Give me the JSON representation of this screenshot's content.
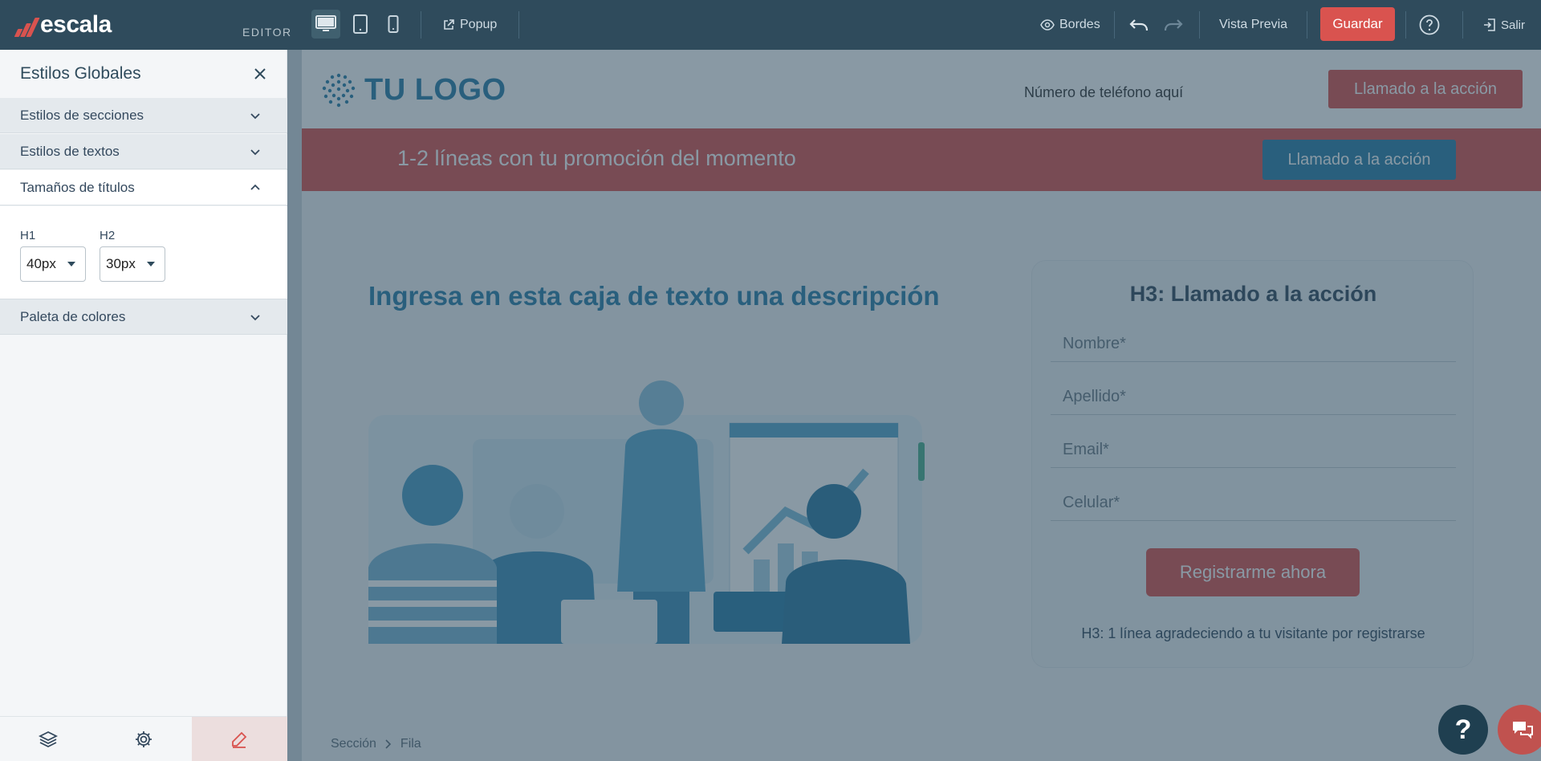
{
  "topbar": {
    "brand": "escala",
    "editor_label": "EDITOR",
    "popup_label": "Popup",
    "borders_label": "Bordes",
    "preview_label": "Vista Previa",
    "save_label": "Guardar",
    "exit_label": "Salir"
  },
  "sidebar": {
    "title": "Estilos Globales",
    "sections": [
      {
        "label": "Estilos de secciones"
      },
      {
        "label": "Estilos de textos"
      },
      {
        "label": "Tamaños de títulos"
      },
      {
        "label": "Paleta de colores"
      }
    ],
    "h1_label": "H1",
    "h1_value": "40px",
    "h2_label": "H2",
    "h2_value": "30px"
  },
  "page": {
    "logo": "TU LOGO",
    "phone": "Número de teléfono aquí",
    "header_cta": "Llamado a la acción",
    "promo_text": "1-2 líneas con tu promoción del momento",
    "promo_cta": "Llamado a la acción",
    "description": "Ingresa  en esta caja de texto una descripción",
    "form": {
      "title": "H3: Llamado a la acción",
      "fields": [
        "Nombre*",
        "Apellido*",
        "Email*",
        "Celular*"
      ],
      "submit": "Registrarme ahora",
      "note": "H3: 1 línea agradeciendo a tu visitante por registrarse"
    }
  },
  "breadcrumb": [
    "Sección",
    "Fila"
  ],
  "help_label": "?",
  "colors": {
    "topbar": "#2f4b5c",
    "accent_red": "#d9534f",
    "accent_blue": "#2a7fa9"
  }
}
